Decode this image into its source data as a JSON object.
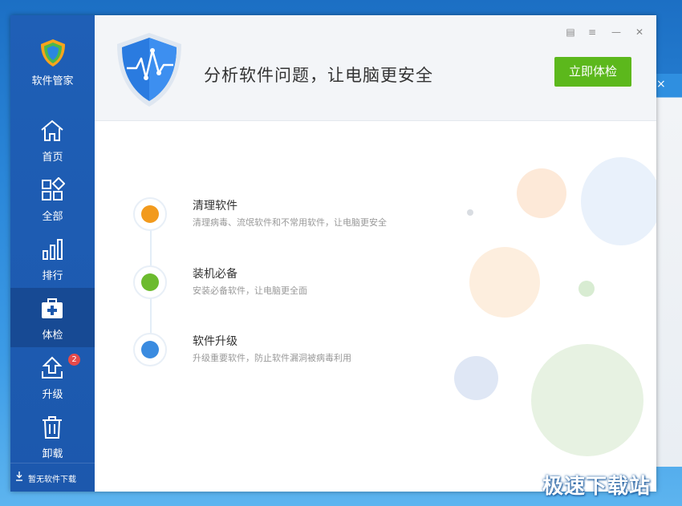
{
  "app": {
    "name": "软件管家"
  },
  "sidebar": {
    "items": [
      {
        "label": "首页",
        "icon": "home-icon"
      },
      {
        "label": "全部",
        "icon": "grid-icon"
      },
      {
        "label": "排行",
        "icon": "bar-chart-icon"
      },
      {
        "label": "体检",
        "icon": "medical-kit-icon",
        "active": true
      },
      {
        "label": "升级",
        "icon": "upgrade-icon",
        "badge": "2"
      },
      {
        "label": "卸载",
        "icon": "trash-icon"
      }
    ],
    "footer": "暂无软件下载"
  },
  "header": {
    "headline": "分析软件问题，让电脑更安全",
    "scan_button": "立即体检"
  },
  "checks": [
    {
      "title": "清理软件",
      "desc": "清理病毒、流氓软件和不常用软件，让电脑更安全",
      "color": "#f29a1d"
    },
    {
      "title": "装机必备",
      "desc": "安装必备软件，让电脑更全面",
      "color": "#6cbb2e"
    },
    {
      "title": "软件升级",
      "desc": "升级重要软件，防止软件漏洞被病毒利用",
      "color": "#3a8be0"
    }
  ],
  "colors": {
    "sidebar": "#1f5fb6",
    "accent": "#5cb81c",
    "shield": "#2a7be0"
  },
  "watermark": "极速下载站",
  "background_close": "×"
}
